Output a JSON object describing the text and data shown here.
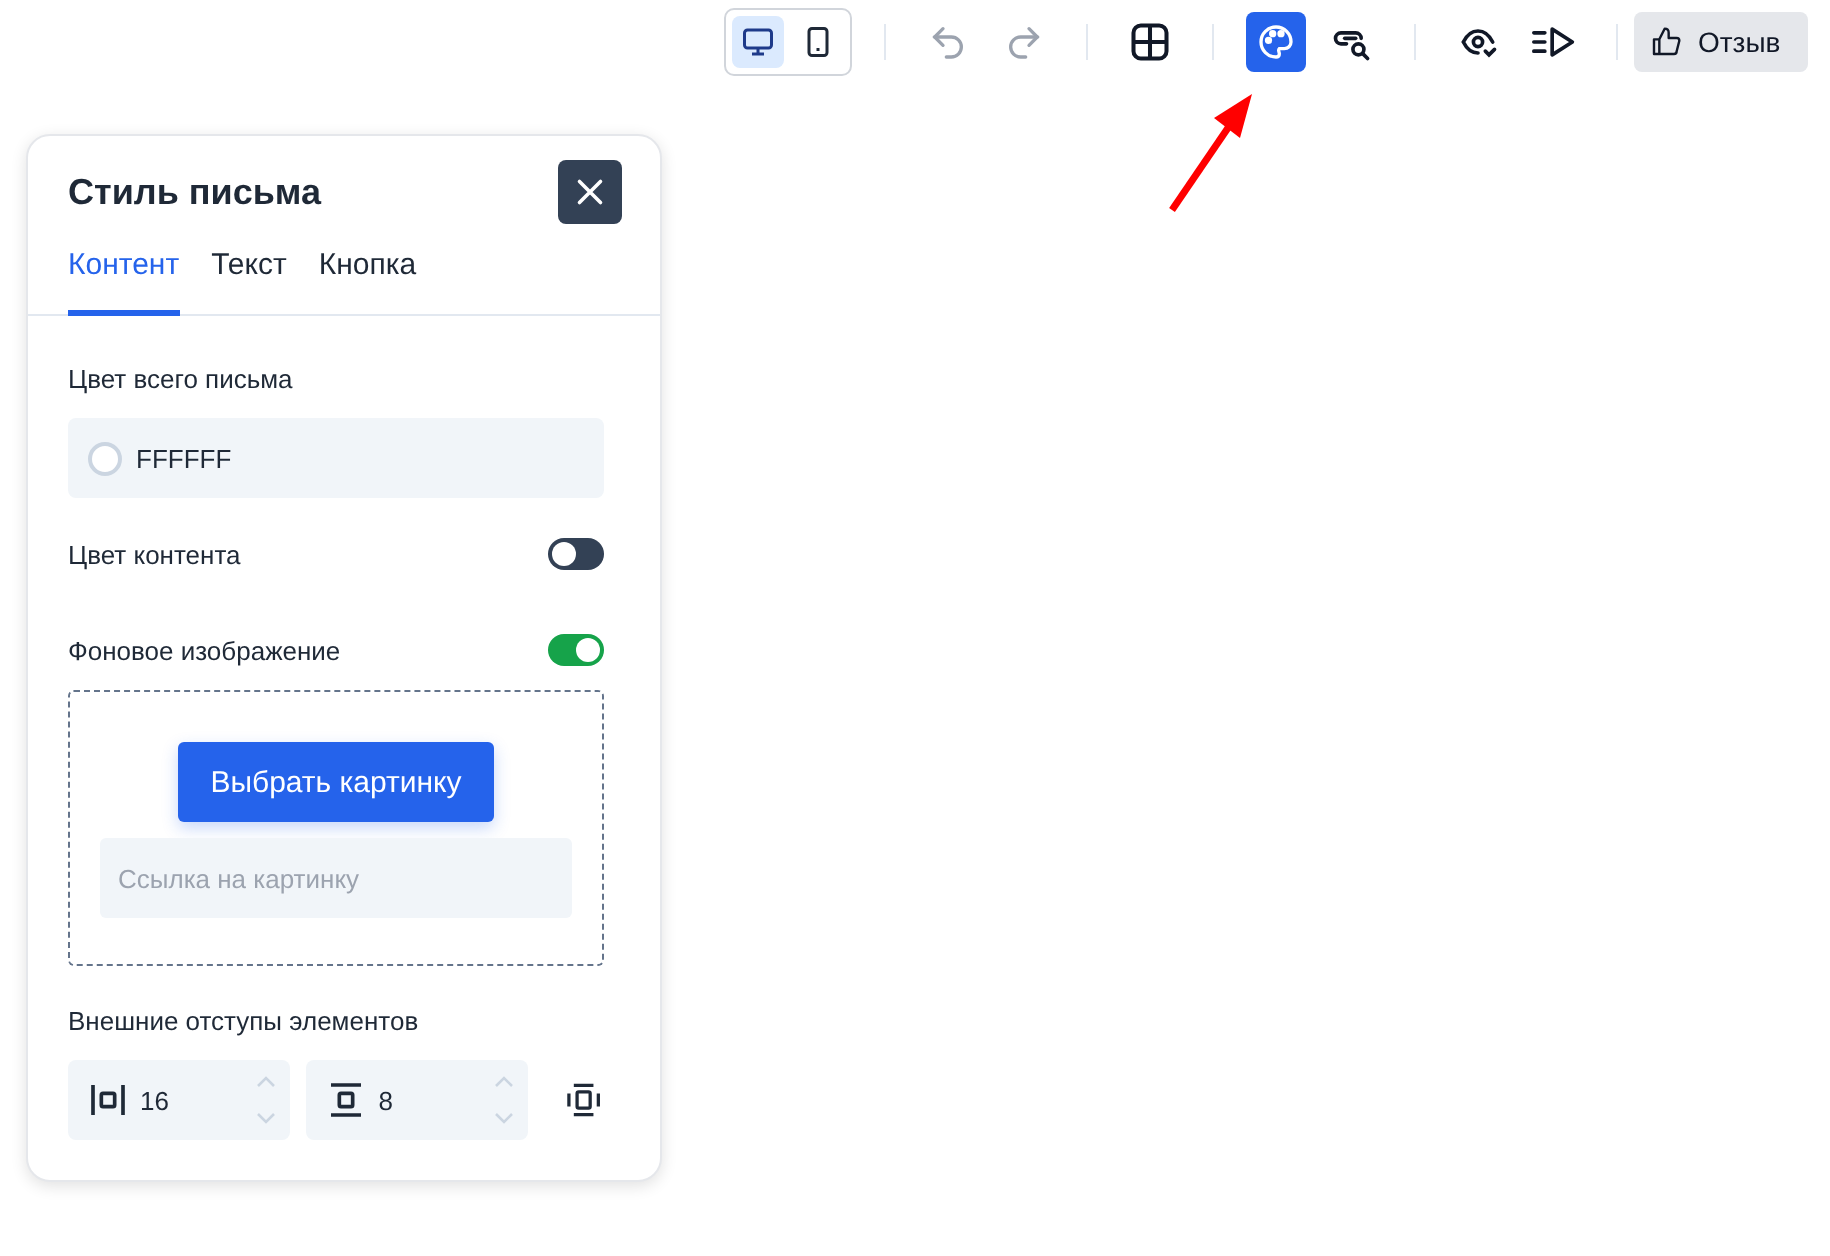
{
  "toolbar": {
    "devices": [
      {
        "kind": "desktop",
        "selected": true
      },
      {
        "kind": "mobile",
        "selected": false
      }
    ],
    "tool_groups": [
      [
        {
          "kind": "undo",
          "disabled": true,
          "selected": false
        },
        {
          "kind": "redo",
          "disabled": true,
          "selected": false
        }
      ],
      [
        {
          "kind": "grid",
          "disabled": false,
          "selected": false
        }
      ],
      [
        {
          "kind": "palette",
          "disabled": false,
          "selected": true
        },
        {
          "kind": "link-search",
          "disabled": false,
          "selected": false
        }
      ],
      [
        {
          "kind": "preview",
          "disabled": false,
          "selected": false
        },
        {
          "kind": "send",
          "disabled": false,
          "selected": false
        }
      ]
    ],
    "feedback_button": "Отзыв"
  },
  "panel": {
    "title": "Стиль письма",
    "tabs": [
      {
        "label": "Контент",
        "selected": true
      },
      {
        "label": "Текст",
        "selected": false
      },
      {
        "label": "Кнопка",
        "selected": false
      }
    ],
    "email_color": {
      "label": "Цвет всего письма",
      "value": "FFFFFF",
      "color": "#ffffff"
    },
    "content_color": {
      "label": "Цвет контента",
      "on": false
    },
    "background_image": {
      "label": "Фоновое изображение",
      "on": true,
      "button": "Выбрать картинку",
      "placeholder": "Ссылка на картинку"
    },
    "margins": {
      "label": "Внешние отступы элементов",
      "horizontal": "16",
      "vertical": "8"
    }
  },
  "annotation": {
    "kind": "arrow"
  }
}
